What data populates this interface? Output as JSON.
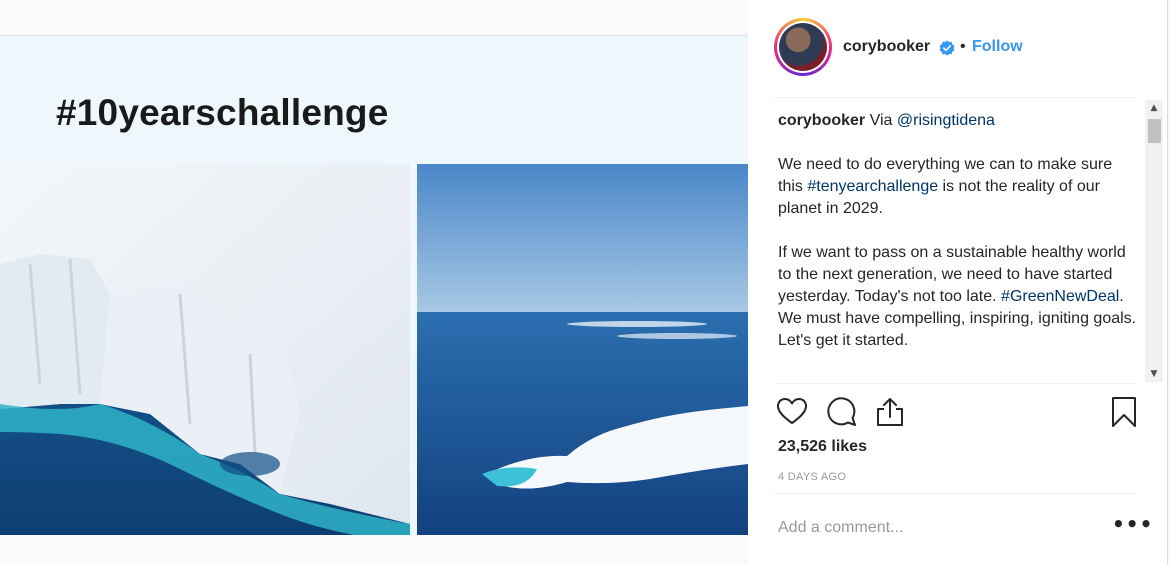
{
  "post": {
    "image": {
      "overlay_text": "#10yearschallenge",
      "left_photo": "glacier-ice-cliff",
      "right_photo": "open-ocean-melted-ice"
    }
  },
  "header": {
    "username": "corybooker",
    "verified_icon": "verified-badge-icon",
    "separator": "•",
    "follow_label": "Follow"
  },
  "caption": {
    "username": "corybooker",
    "intro": " Via ",
    "mention": "@risingtidena",
    "p1_before": "We need to do everything we can to make sure this ",
    "p1_hashtag": "#tenyearchallenge",
    "p1_after": " is not the reality of our planet in 2029.",
    "p2_before": "If we want to pass on a sustainable healthy world to the next generation, we need to have started yesterday. Today's not too late. ",
    "p2_hashtag": "#GreenNewDeal",
    "p2_after": ". We must have compelling, inspiring, igniting goals. Let's get it started."
  },
  "actions": {
    "icons": [
      "heart-icon",
      "comment-icon",
      "share-icon",
      "bookmark-icon"
    ]
  },
  "stats": {
    "likes": "23,526 likes",
    "timestamp": "4 DAYS AGO"
  },
  "comment": {
    "placeholder": "Add a comment...",
    "more_label": "•••"
  },
  "colors": {
    "follow": "#3897f0",
    "link": "#003569",
    "muted": "#999999",
    "text": "#262626"
  }
}
